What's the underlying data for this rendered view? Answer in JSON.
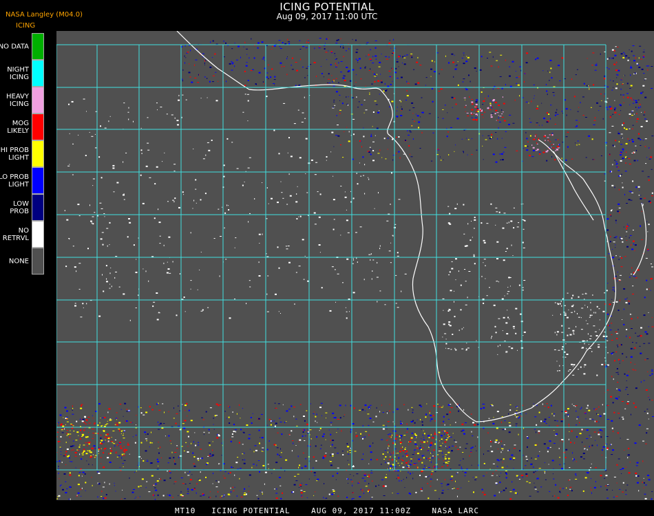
{
  "header": {
    "title": "ICING POTENTIAL",
    "subtitle": "Aug 09, 2017 11:00 UTC",
    "brand": "NASA Langley (M04.0)",
    "brand_sub": "ICING"
  },
  "legend": {
    "items": [
      {
        "label": "NO DATA",
        "color": "#00b000"
      },
      {
        "label": "NIGHT\nICING",
        "color": "#00ffff"
      },
      {
        "label": "HEAVY\nICING",
        "color": "#f0a0e0"
      },
      {
        "label": "MOG\nLIKELY",
        "color": "#ff0000"
      },
      {
        "label": "HI PROB\nLIGHT",
        "color": "#ffff00"
      },
      {
        "label": "LO PROB\nLIGHT",
        "color": "#0000ff"
      },
      {
        "label": "LOW\nPROB",
        "color": "#000080"
      },
      {
        "label": "NO\nRETRVL",
        "color": "#ffffff"
      },
      {
        "label": "NONE",
        "color": "#505050"
      }
    ]
  },
  "map": {
    "background": "#505050",
    "grid_color": "#40e0e0",
    "coast_color": "#ffffff",
    "grid_label_color": "#cc2020"
  },
  "footer": {
    "text": "MT10   ICING POTENTIAL    AUG 09, 2017 11:00Z    NASA LARC"
  }
}
